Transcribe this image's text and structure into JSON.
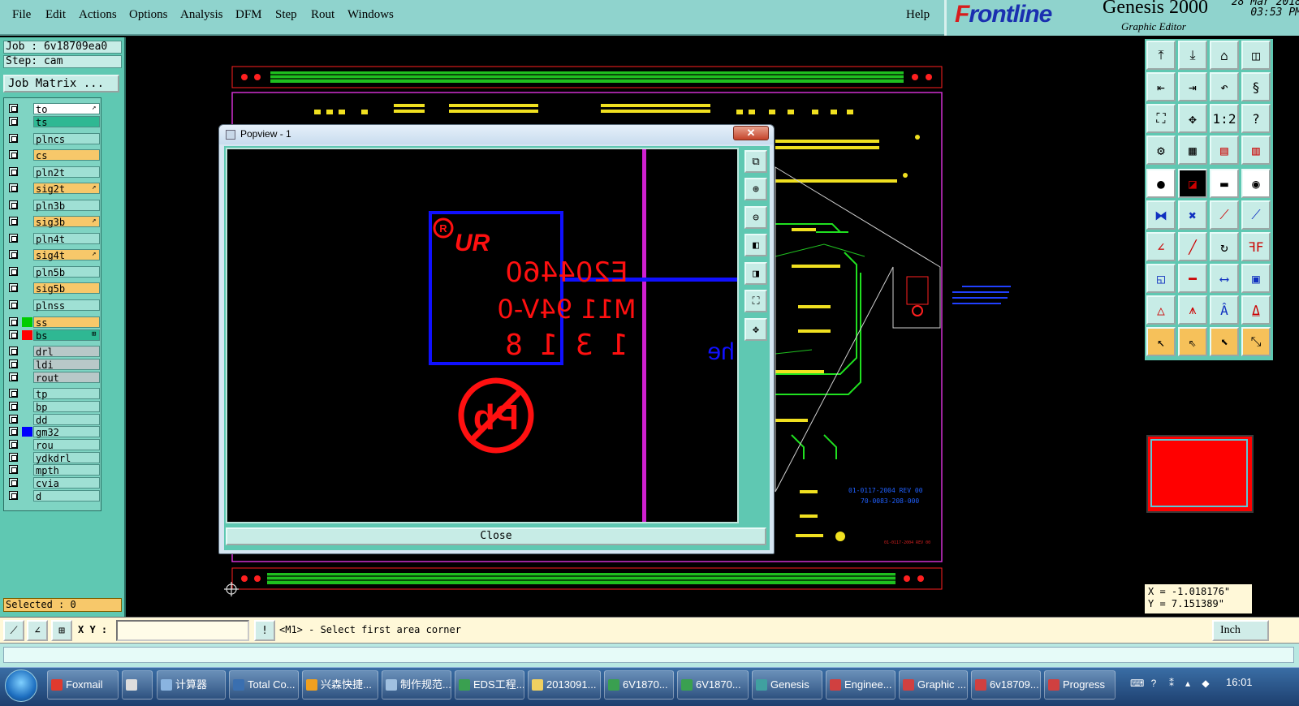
{
  "menu": {
    "items": [
      "File",
      "Edit",
      "Actions",
      "Options",
      "Analysis",
      "DFM",
      "Step",
      "Rout",
      "Windows"
    ],
    "help": "Help"
  },
  "brand": {
    "logo_f": "F",
    "logo_rest": "rontline",
    "title": "Genesis 2000",
    "subtitle": "Graphic Editor",
    "date": "28 Mar 2018",
    "time": "03:53 PM"
  },
  "job": {
    "job_label": "Job : 6v18709ea0",
    "step_label": "Step: cam",
    "matrix_button": "Job Matrix ..."
  },
  "layers": [
    {
      "name": "to",
      "color": "#ffffff",
      "flag": "↗",
      "swatch": ""
    },
    {
      "name": "ts",
      "color": "#2fb893",
      "flag": "",
      "swatch": ""
    },
    {
      "name": "plncs",
      "color": "#9fe0d4",
      "flag": "",
      "swatch": ""
    },
    {
      "name": "cs",
      "color": "#f7c86a",
      "flag": "",
      "swatch": ""
    },
    {
      "name": "pln2t",
      "color": "#9fe0d4",
      "flag": "",
      "swatch": ""
    },
    {
      "name": "sig2t",
      "color": "#f7c86a",
      "flag": "↗",
      "swatch": ""
    },
    {
      "name": "pln3b",
      "color": "#9fe0d4",
      "flag": "",
      "swatch": ""
    },
    {
      "name": "sig3b",
      "color": "#f7c86a",
      "flag": "↗",
      "swatch": ""
    },
    {
      "name": "pln4t",
      "color": "#9fe0d4",
      "flag": "",
      "swatch": ""
    },
    {
      "name": "sig4t",
      "color": "#f7c86a",
      "flag": "↗",
      "swatch": ""
    },
    {
      "name": "pln5b",
      "color": "#9fe0d4",
      "flag": "",
      "swatch": ""
    },
    {
      "name": "sig5b",
      "color": "#f7c86a",
      "flag": "",
      "swatch": ""
    },
    {
      "name": "plnss",
      "color": "#9fe0d4",
      "flag": "",
      "swatch": ""
    },
    {
      "name": "ss",
      "color": "#f7c86a",
      "flag": "",
      "swatch": "#00cc00"
    },
    {
      "name": "bs",
      "color": "#2fb893",
      "flag": "⊞",
      "swatch": "#ff0000"
    },
    {
      "name": "drl",
      "color": "#b8c8c8",
      "flag": "",
      "swatch": ""
    },
    {
      "name": "ldi",
      "color": "#b8c8c8",
      "flag": "",
      "swatch": ""
    },
    {
      "name": "rout",
      "color": "#b8c8c8",
      "flag": "",
      "swatch": ""
    },
    {
      "name": "tp",
      "color": "#9fe0d4",
      "flag": "",
      "swatch": ""
    },
    {
      "name": "bp",
      "color": "#9fe0d4",
      "flag": "",
      "swatch": ""
    },
    {
      "name": "dd",
      "color": "#9fe0d4",
      "flag": "",
      "swatch": ""
    },
    {
      "name": "gm32",
      "color": "#9fe0d4",
      "flag": "",
      "swatch": "#0000ff"
    },
    {
      "name": "rou",
      "color": "#9fe0d4",
      "flag": "",
      "swatch": ""
    },
    {
      "name": "ydkdrl",
      "color": "#9fe0d4",
      "flag": "",
      "swatch": ""
    },
    {
      "name": "mpth",
      "color": "#9fe0d4",
      "flag": "",
      "swatch": ""
    },
    {
      "name": "cvia",
      "color": "#9fe0d4",
      "flag": "",
      "swatch": ""
    },
    {
      "name": "d",
      "color": "#9fe0d4",
      "flag": "",
      "swatch": ""
    }
  ],
  "selected": "Selected : 0",
  "coords": {
    "x": "X = -1.018176\"",
    "y": "Y = 7.151389\""
  },
  "popview": {
    "title": "Popview - 1",
    "close_x": "✕",
    "close_button": "Close",
    "marking": {
      "logo_r": "R",
      "logo_ur": "UR",
      "line1": "E204460",
      "line2": "M11 94V-0",
      "line3": "1 3 1 8",
      "pb": "Pb",
      "partial_text": "he"
    }
  },
  "board_text": {
    "rev": "01-0117-2004 REV 00",
    "pn": "70-0083-208-000",
    "small": "01-0117-2004 REV 00"
  },
  "cmdbar": {
    "xy_label": "X Y :",
    "xy_value": "",
    "message": "<M1> - Select first area corner",
    "unit": "Inch"
  },
  "taskbar": {
    "tasks": [
      {
        "label": "Foxmail",
        "color": "#e03a2e"
      },
      {
        "label": "",
        "color": "#ddd"
      },
      {
        "label": "计算器",
        "color": "#8ab4e0"
      },
      {
        "label": "Total Co...",
        "color": "#3a6fb0"
      },
      {
        "label": "兴森快捷...",
        "color": "#f0a020"
      },
      {
        "label": "制作规范...",
        "color": "#a0c0e0"
      },
      {
        "label": "EDS工程...",
        "color": "#3aa050"
      },
      {
        "label": "2013091...",
        "color": "#f0d060"
      },
      {
        "label": "6V1870...",
        "color": "#3aa050"
      },
      {
        "label": "6V1870...",
        "color": "#3aa050"
      },
      {
        "label": "Genesis",
        "color": "#40a0a0"
      },
      {
        "label": "Enginee...",
        "color": "#d04040"
      },
      {
        "label": "Graphic ...",
        "color": "#d04040"
      },
      {
        "label": "6v18709...",
        "color": "#d04040"
      },
      {
        "label": "Progress",
        "color": "#d04040"
      }
    ],
    "clock": "16:01"
  }
}
